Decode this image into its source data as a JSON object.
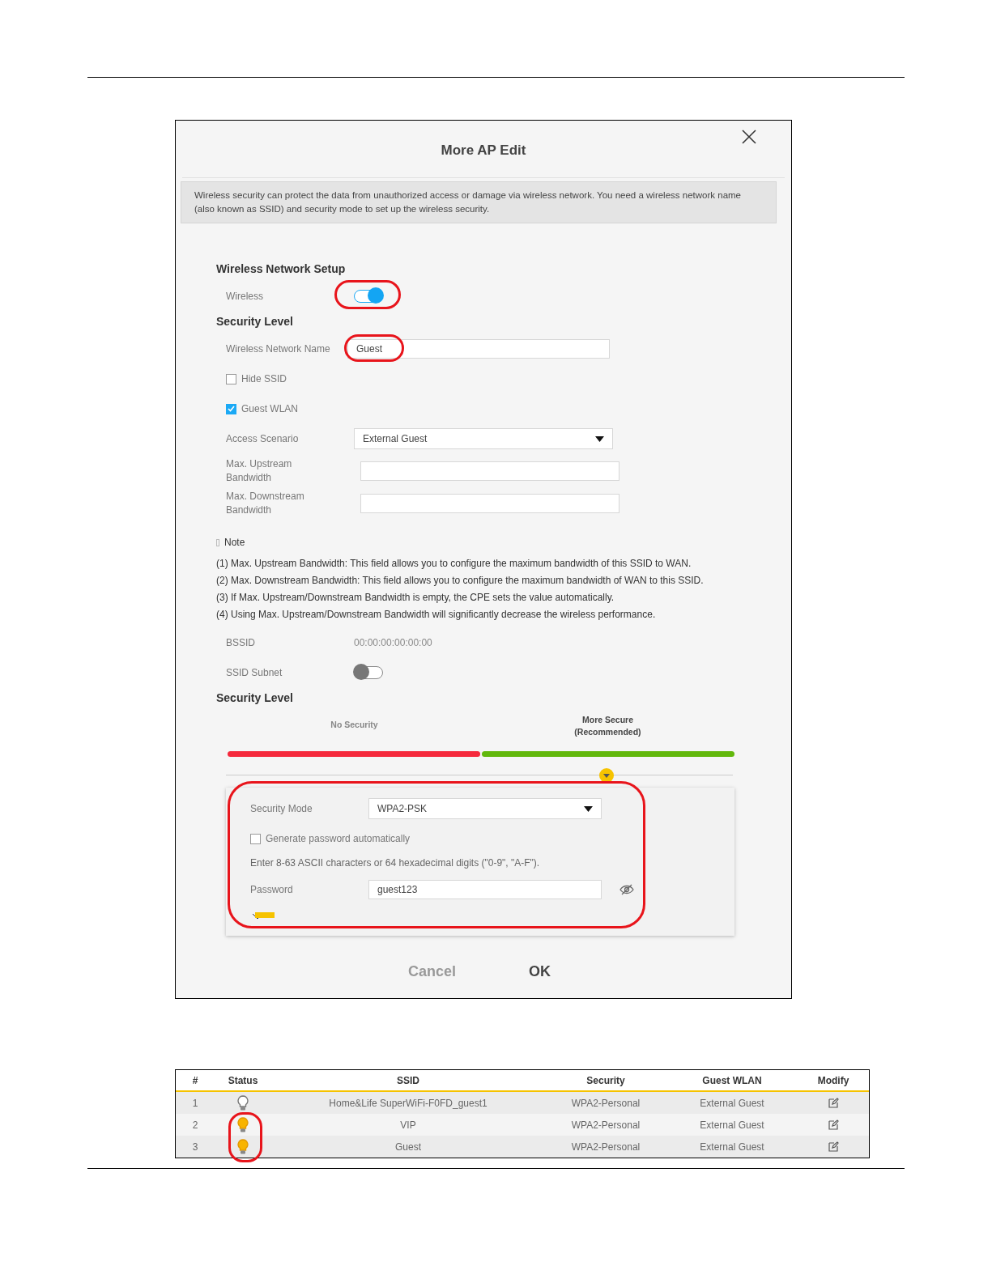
{
  "dialog": {
    "title": "More AP Edit",
    "info": "Wireless security can protect the data from unauthorized access or damage via wireless network. You need a wireless network name (also known as SSID) and security mode to set up the wireless security.",
    "setup_heading": "Wireless Network Setup",
    "wireless": {
      "label": "Wireless",
      "on": true
    },
    "security_heading": "Security Level",
    "network_name": {
      "label": "Wireless Network Name",
      "value": "Guest"
    },
    "checkboxes": [
      {
        "label": "Hide SSID",
        "checked": false
      },
      {
        "label": "Guest WLAN",
        "checked": true
      }
    ],
    "access_scenario": {
      "label": "Access Scenario",
      "value": "External Guest"
    },
    "bandwidth_fields": [
      {
        "label": "Max. Upstream Bandwidth"
      },
      {
        "label": "Max. Downstream Bandwidth"
      }
    ],
    "note_title": "Note",
    "notes": [
      "(1) Max. Upstream Bandwidth: This field allows you to configure the maximum bandwidth of this SSID to WAN.",
      "(2) Max. Downstream Bandwidth: This field allows you to configure the maximum bandwidth of WAN to this SSID.",
      "(3) If Max. Upstream/Downstream Bandwidth is empty, the CPE sets the value automatically.",
      "(4) Using Max. Upstream/Downstream Bandwidth will significantly decrease the wireless performance."
    ],
    "bssid": {
      "label": "BSSID",
      "value": "00:00:00:00:00:00"
    },
    "ssid_subnet": {
      "label": "SSID Subnet",
      "on": false
    },
    "security_level": {
      "heading": "Security Level",
      "low_label": "No Security",
      "high_label": "More Secure (Recommended)",
      "level": 0.75
    },
    "security_mode": {
      "label": "Security Mode",
      "value": "WPA2-PSK"
    },
    "generate_password": {
      "label": "Generate password automatically",
      "checked": false
    },
    "password_hint": "Enter 8-63 ASCII characters or 64 hexadecimal digits (\"0-9\", \"A-F\").",
    "password": {
      "label": "Password",
      "value": "guest123"
    },
    "buttons": [
      "Cancel",
      "OK"
    ]
  },
  "table": {
    "columns": [
      "#",
      "Status",
      "SSID",
      "Security",
      "Guest WLAN",
      "Modify"
    ],
    "rows": [
      {
        "index": "1",
        "on": false,
        "ssid": "Home&Life SuperWiFi-F0FD_guest1",
        "security": "WPA2-Personal",
        "guest_wlan": "External Guest"
      },
      {
        "index": "2",
        "on": true,
        "ssid": "VIP",
        "security": "WPA2-Personal",
        "guest_wlan": "External Guest"
      },
      {
        "index": "3",
        "on": true,
        "ssid": "Guest",
        "security": "WPA2-Personal",
        "guest_wlan": "External Guest"
      }
    ]
  }
}
